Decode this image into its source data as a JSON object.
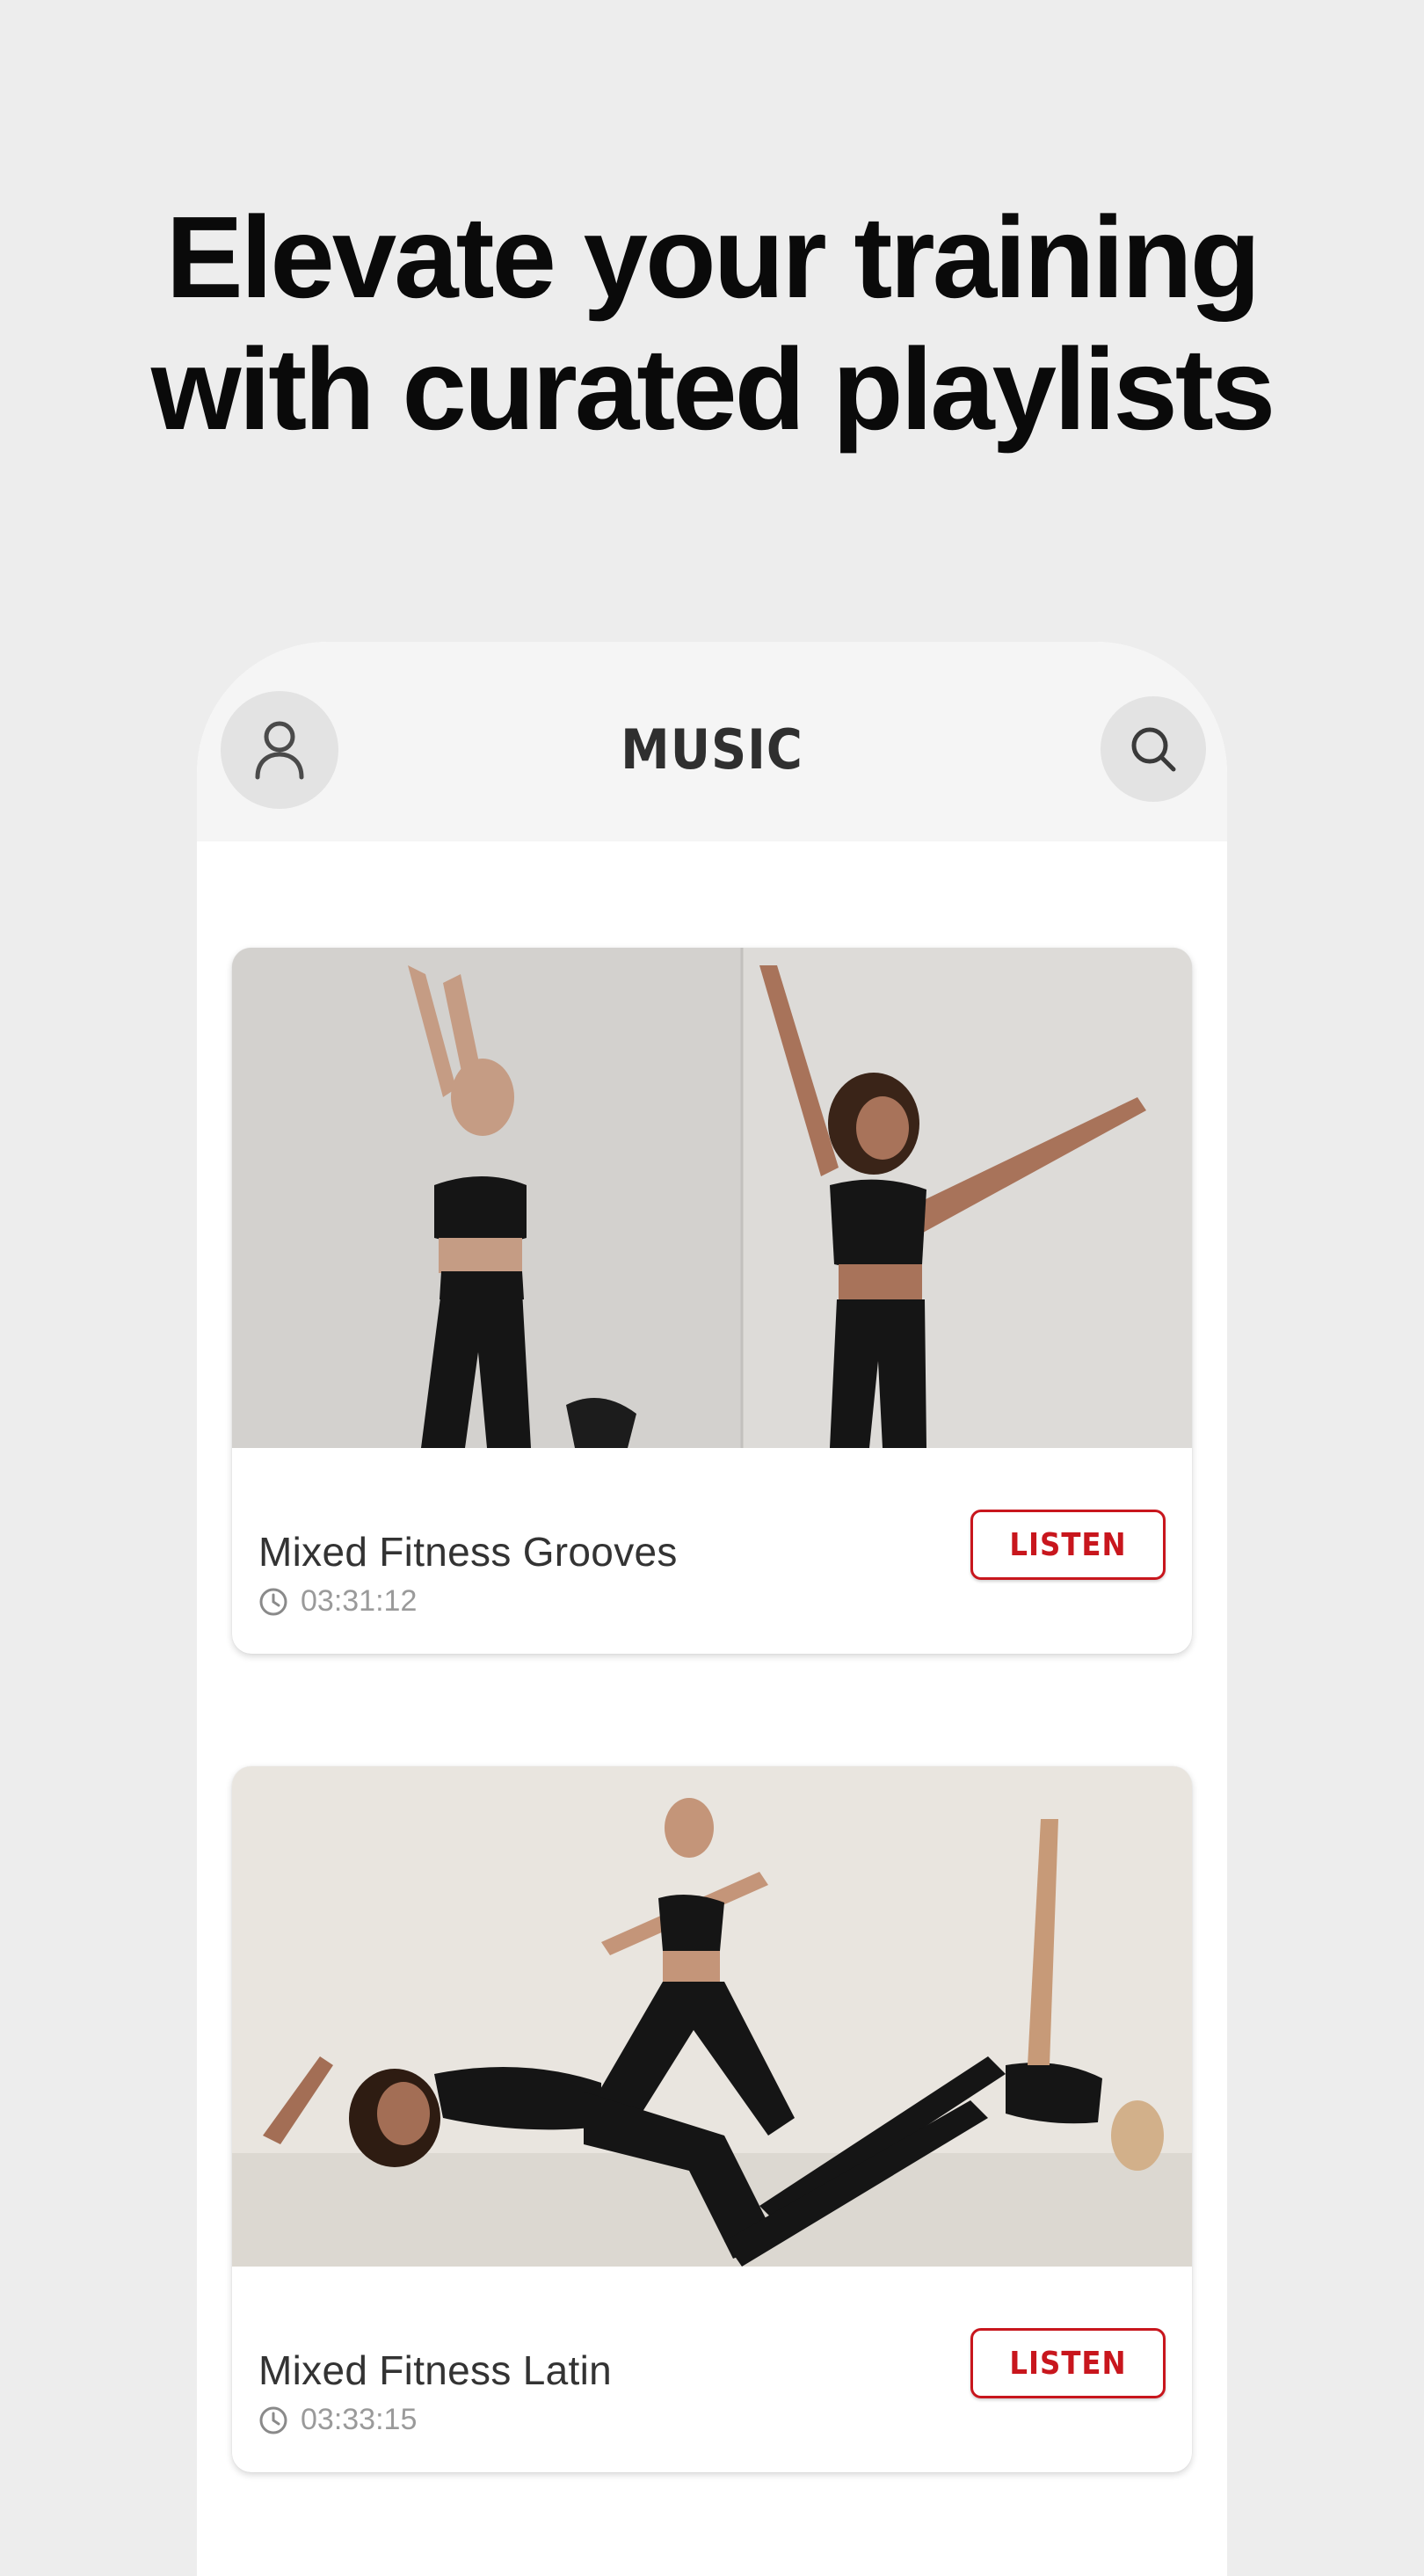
{
  "headline": {
    "line1": "Elevate your training",
    "line2": "with curated playlists"
  },
  "app": {
    "title": "MUSIC",
    "profile_icon": "person-icon",
    "search_icon": "search-icon"
  },
  "playlists": [
    {
      "title": "Mixed Fitness Grooves",
      "duration": "03:31:12",
      "button_label": "LISTEN"
    },
    {
      "title": "Mixed Fitness Latin",
      "duration": "03:33:15",
      "button_label": "LISTEN"
    }
  ],
  "colors": {
    "background": "#ededed",
    "accent": "#c8161d",
    "header": "#f5f5f5"
  }
}
